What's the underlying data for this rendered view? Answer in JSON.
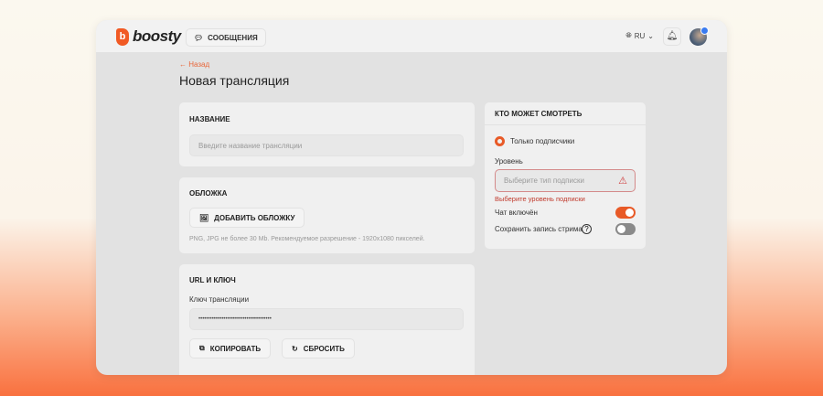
{
  "header": {
    "logo": "boosty",
    "messages": "СООБЩЕНИЯ",
    "lang": "RU"
  },
  "page": {
    "back": "Назад",
    "title": "Новая трансляция"
  },
  "name_card": {
    "title": "НАЗВАНИЕ",
    "placeholder": "Введите название трансляции"
  },
  "cover_card": {
    "title": "ОБЛОЖКА",
    "button": "ДОБАВИТЬ ОБЛОЖКУ",
    "hint": "PNG, JPG не более 30 Mb. Рекомендуемое разрешение - 1920x1080 пикселей."
  },
  "url_card": {
    "title": "URL И КЛЮЧ",
    "key_label": "Ключ трансляции",
    "key_value": "••••••••••••••••••••••••••••••••••••••",
    "copy": "КОПИРОВАТЬ",
    "reset": "СБРОСИТЬ"
  },
  "access_card": {
    "title": "КТО МОЖЕТ СМОТРЕТЬ",
    "radio": "Только подписчики",
    "level_label": "Уровень",
    "level_placeholder": "Выберите тип подписки",
    "error": "Выберите уровень подписки",
    "chat": "Чат включён",
    "chat_on": true,
    "save": "Сохранить запись стрима",
    "save_on": false
  }
}
